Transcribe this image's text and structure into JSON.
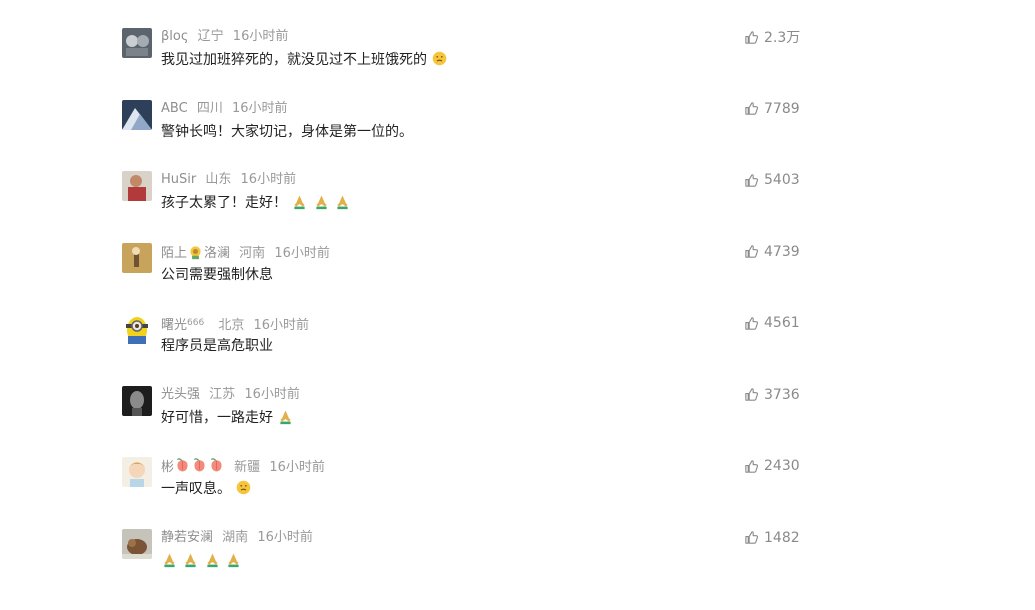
{
  "comments": [
    {
      "username": "βloς",
      "location": "辽宁",
      "time": "16小时前",
      "content": "我见过加班猝死的，就没见过不上班饿死的",
      "likes": "2.3万",
      "avatar_color": "#7a7f86",
      "content_emojis": [
        "face-emoji"
      ]
    },
    {
      "username": "ABC",
      "location": "四川",
      "time": "16小时前",
      "content": "警钟长鸣！大家切记，身体是第一位的。",
      "likes": "7789",
      "avatar_color": "#2e3f59"
    },
    {
      "username": "HuSir",
      "location": "山东",
      "time": "16小时前",
      "content": "孩子太累了！走好！",
      "likes": "5403",
      "avatar_color": "#b23a3a",
      "content_emojis": [
        "pray-emoji",
        "pray-emoji",
        "pray-emoji"
      ]
    },
    {
      "username": "陌上",
      "username_suffix": "洛澜",
      "location": "河南",
      "time": "16小时前",
      "content": "公司需要强制休息",
      "likes": "4739",
      "avatar_color": "#c8a35c",
      "name_emoji": "flower-emoji"
    },
    {
      "username": "曙光",
      "username_badge": "666",
      "location": "北京",
      "time": "16小时前",
      "content": "程序员是高危职业",
      "likes": "4561",
      "avatar_color": "#f2d21a"
    },
    {
      "username": "光头强",
      "location": "江苏",
      "time": "16小时前",
      "content": "好可惜，一路走好",
      "likes": "3736",
      "avatar_color": "#232323",
      "content_emojis": [
        "pray-emoji"
      ]
    },
    {
      "username": "彬",
      "location": "新疆",
      "time": "16小时前",
      "content": "一声叹息。",
      "likes": "2430",
      "avatar_color": "#e8d8c0",
      "name_emojis": [
        "peach-emoji",
        "peach-emoji",
        "peach-emoji"
      ],
      "content_emojis": [
        "face-emoji"
      ]
    },
    {
      "username": "静若安澜",
      "location": "湖南",
      "time": "16小时前",
      "content": "",
      "likes": "1482",
      "avatar_color": "#b7b2a6",
      "content_emojis": [
        "pray-emoji",
        "pray-emoji",
        "pray-emoji",
        "pray-emoji"
      ]
    }
  ],
  "icons": {
    "like": "thumbs-up-icon"
  },
  "colors": {
    "meta_text": "#999999",
    "content_text": "#222222"
  }
}
